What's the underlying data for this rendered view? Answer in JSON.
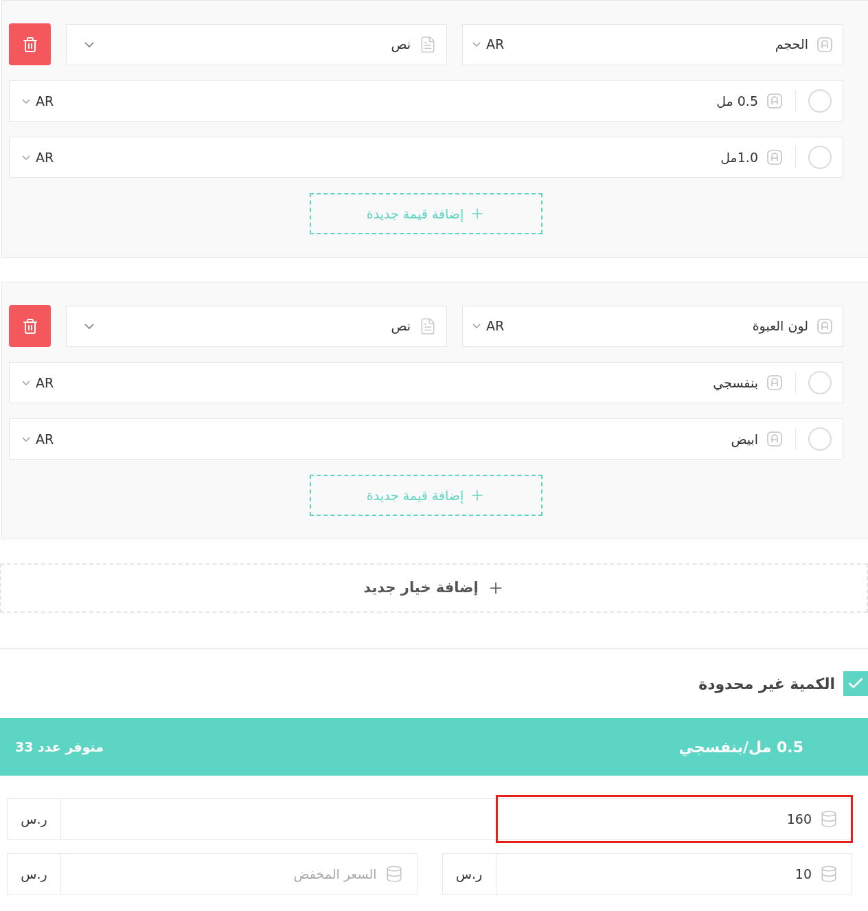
{
  "options": [
    {
      "name": "الحجم",
      "name_lang": "AR",
      "type": "نص",
      "values": [
        {
          "label": "0.5 مل",
          "lang": "AR",
          "selected": false
        },
        {
          "label": "1.0مل",
          "lang": "AR",
          "selected": false
        }
      ],
      "add_value": "إضافة قيمة جديدة"
    },
    {
      "name": "لون العبوة",
      "name_lang": "AR",
      "type": "نص",
      "values": [
        {
          "label": "بنفسجي",
          "lang": "AR",
          "selected": false
        },
        {
          "label": "ابيض",
          "lang": "AR",
          "selected": false
        }
      ],
      "add_value": "إضافة قيمة جديدة"
    }
  ],
  "add_option": "إضافة خيار جديد",
  "unlimited": {
    "label": "الكمية غير محدودة",
    "checked": true
  },
  "variant": {
    "title": "0.5 مل/بنفسجي",
    "stock": "متوفر عدد 33",
    "price": {
      "value": "160",
      "currency": "ر.س",
      "highlighted": true
    },
    "cost": {
      "value": "10",
      "currency": "ر.س"
    },
    "sale": {
      "placeholder": "السعر المخفض",
      "currency": "ر.س"
    }
  }
}
